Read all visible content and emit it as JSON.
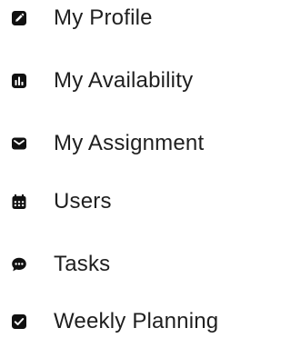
{
  "menu": {
    "items": [
      {
        "label": "My Profile",
        "icon": "edit-square-icon"
      },
      {
        "label": "My Availability",
        "icon": "bar-chart-square-icon"
      },
      {
        "label": "My Assignment",
        "icon": "envelope-icon"
      },
      {
        "label": "Users",
        "icon": "calendar-icon"
      },
      {
        "label": "Tasks",
        "icon": "chat-bubble-icon"
      },
      {
        "label": "Weekly Planning",
        "icon": "checkbox-checked-icon"
      }
    ]
  },
  "colors": {
    "text": "#1f1f1f",
    "icon": "#111111",
    "background": "#ffffff"
  }
}
